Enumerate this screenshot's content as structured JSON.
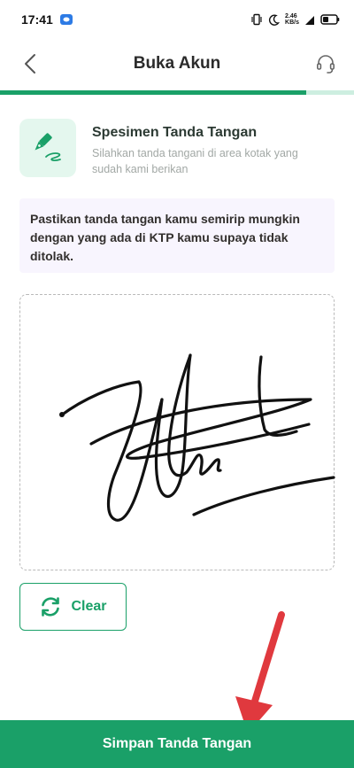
{
  "status_bar": {
    "time": "17:41",
    "signal_label": "2.46 KB/s",
    "icons": [
      "app-notification-icon",
      "vibrate-icon",
      "moon-icon",
      "signal-icon",
      "battery-icon"
    ]
  },
  "header": {
    "title": "Buka Akun",
    "back_icon": "chevron-left-icon",
    "help_icon": "headset-icon"
  },
  "progress": {
    "fraction": 0.865,
    "fill_color": "#1aa068",
    "track_color": "#cdeee0"
  },
  "intro": {
    "icon": "pen-signature-icon",
    "title": "Spesimen Tanda Tangan",
    "description": "Silahkan tanda tangani di area kotak yang sudah kami berikan"
  },
  "notice": {
    "text": "Pastikan tanda tangan kamu semirip mungkin dengan yang ada di KTP kamu supaya tidak ditolak."
  },
  "signature_pad": {
    "has_signature": true
  },
  "actions": {
    "clear_label": "Clear",
    "clear_icon": "refresh-icon",
    "submit_label": "Simpan Tanda Tangan"
  },
  "colors": {
    "accent": "#1aa068",
    "annotation": "#e0393e"
  }
}
